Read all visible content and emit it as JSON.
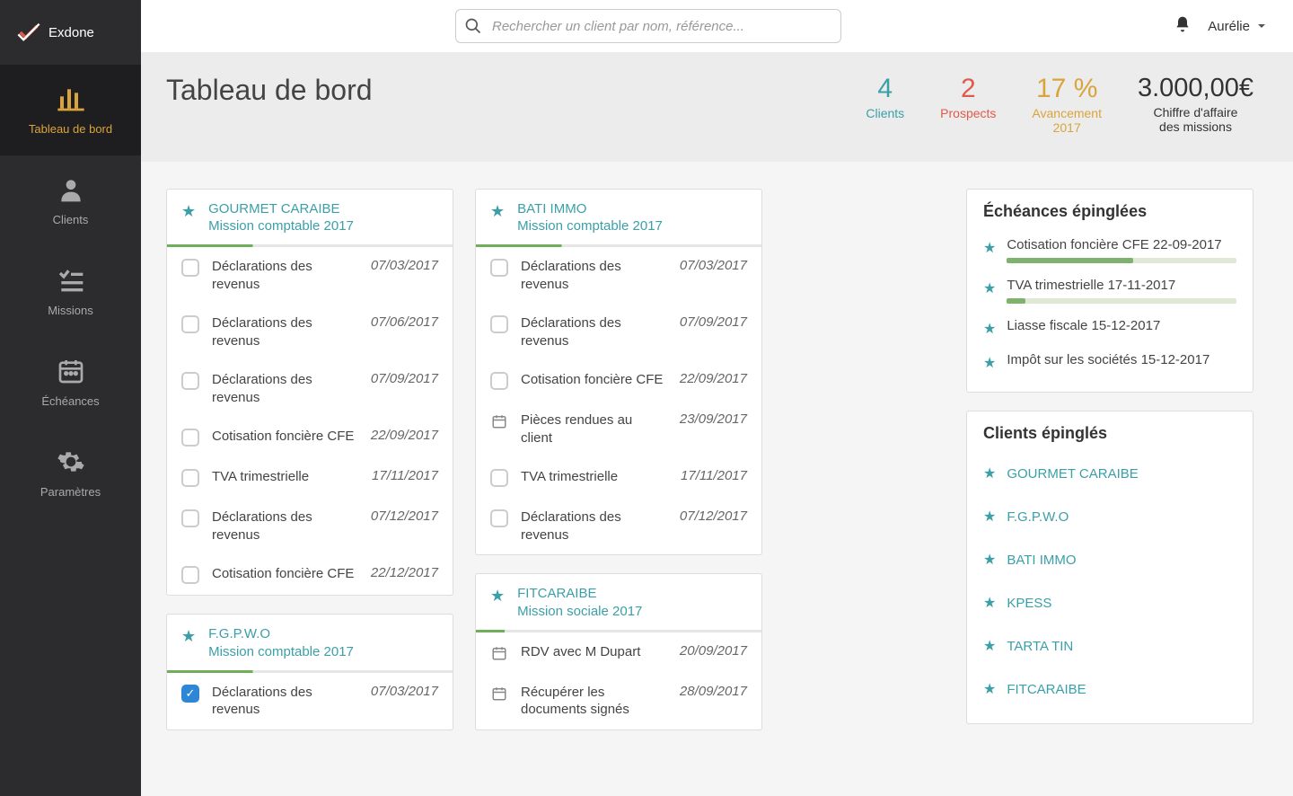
{
  "app_name": "Exdone",
  "search": {
    "placeholder": "Rechercher un client par nom, référence..."
  },
  "user": {
    "name": "Aurélie"
  },
  "sidebar": {
    "items": [
      {
        "label": "Tableau de bord",
        "active": true
      },
      {
        "label": "Clients",
        "active": false
      },
      {
        "label": "Missions",
        "active": false
      },
      {
        "label": "Échéances",
        "active": false
      },
      {
        "label": "Paramètres",
        "active": false
      }
    ]
  },
  "page_title": "Tableau de bord",
  "kpis": {
    "clients": {
      "value": "4",
      "label": "Clients"
    },
    "prospects": {
      "value": "2",
      "label": "Prospects"
    },
    "progress": {
      "value": "17 %",
      "label": "Avancement",
      "sub": "2017"
    },
    "revenue": {
      "value": "3.000,00€",
      "label": "Chiffre d'affaire",
      "sub": "des missions"
    }
  },
  "missions": {
    "colA": [
      {
        "client": "GOURMET CARAIBE",
        "mission": "Mission comptable 2017",
        "progress": 30,
        "rows": [
          {
            "type": "check",
            "checked": false,
            "text": "Déclarations des revenus",
            "date": "07/03/2017"
          },
          {
            "type": "check",
            "checked": false,
            "text": "Déclarations des revenus",
            "date": "07/06/2017"
          },
          {
            "type": "check",
            "checked": false,
            "text": "Déclarations des revenus",
            "date": "07/09/2017"
          },
          {
            "type": "check",
            "checked": false,
            "text": "Cotisation foncière CFE",
            "date": "22/09/2017"
          },
          {
            "type": "check",
            "checked": false,
            "text": "TVA trimestrielle",
            "date": "17/11/2017"
          },
          {
            "type": "check",
            "checked": false,
            "text": "Déclarations des revenus",
            "date": "07/12/2017"
          },
          {
            "type": "check",
            "checked": false,
            "text": "Cotisation foncière CFE",
            "date": "22/12/2017"
          }
        ]
      },
      {
        "client": "F.G.P.W.O",
        "mission": "Mission comptable 2017",
        "progress": 30,
        "rows": [
          {
            "type": "check",
            "checked": true,
            "text": "Déclarations des revenus",
            "date": "07/03/2017"
          }
        ]
      }
    ],
    "colB": [
      {
        "client": "BATI IMMO",
        "mission": "Mission comptable 2017",
        "progress": 30,
        "rows": [
          {
            "type": "check",
            "checked": false,
            "text": "Déclarations des revenus",
            "date": "07/03/2017"
          },
          {
            "type": "check",
            "checked": false,
            "text": "Déclarations des revenus",
            "date": "07/09/2017"
          },
          {
            "type": "check",
            "checked": false,
            "text": "Cotisation foncière CFE",
            "date": "22/09/2017"
          },
          {
            "type": "cal",
            "text": "Pièces rendues au client",
            "date": "23/09/2017"
          },
          {
            "type": "check",
            "checked": false,
            "text": "TVA trimestrielle",
            "date": "17/11/2017"
          },
          {
            "type": "check",
            "checked": false,
            "text": "Déclarations des revenus",
            "date": "07/12/2017"
          }
        ]
      },
      {
        "client": "FITCARAIBE",
        "mission": "Mission sociale 2017",
        "progress": 10,
        "rows": [
          {
            "type": "cal",
            "text": "RDV avec M Dupart",
            "date": "20/09/2017"
          },
          {
            "type": "cal",
            "text": "Récupérer les documents signés",
            "date": "28/09/2017"
          }
        ]
      }
    ]
  },
  "pinned_deadlines": {
    "title": "Échéances épinglées",
    "items": [
      {
        "text": "Cotisation foncière CFE 22-09-2017",
        "progress": 55
      },
      {
        "text": "TVA trimestrielle 17-11-2017",
        "progress": 8
      },
      {
        "text": "Liasse fiscale 15-12-2017",
        "progress": null
      },
      {
        "text": "Impôt sur les sociétés 15-12-2017",
        "progress": null
      }
    ]
  },
  "pinned_clients": {
    "title": "Clients épinglés",
    "items": [
      "GOURMET CARAIBE",
      "F.G.P.W.O",
      "BATI IMMO",
      "KPESS",
      "TARTA TIN",
      "FITCARAIBE"
    ]
  }
}
